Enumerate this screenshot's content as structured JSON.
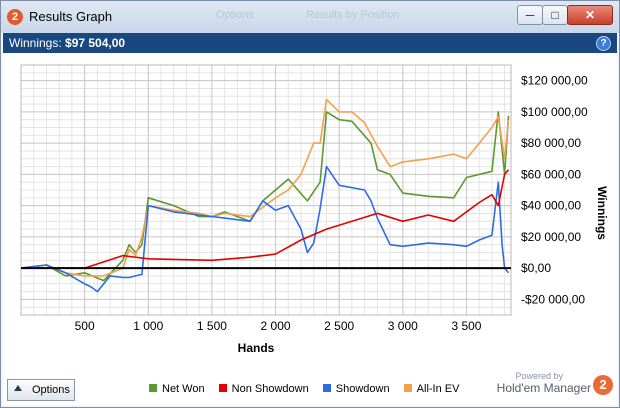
{
  "window": {
    "title": "Results Graph",
    "app_icon": "hm2-logo-icon",
    "background_tabs": [
      "Options",
      "Results by Position"
    ],
    "controls": {
      "minimize": "─",
      "maximize": "□",
      "close": "✕"
    }
  },
  "header": {
    "label": "Winnings:",
    "value": "$97 504,00",
    "help": "?"
  },
  "footer": {
    "options_label": "Options",
    "powered_by": "Powered by",
    "brand": "Hold'em Manager",
    "brand_logo_text": "2"
  },
  "colors": {
    "net_won": "#5a9a2e",
    "non_showdown": "#e30000",
    "showdown": "#2e6be6",
    "all_in_ev": "#f6a04d",
    "title_bar": "#19477f"
  },
  "chart_data": {
    "type": "line",
    "xlabel": "Hands",
    "ylabel": "Winnings",
    "xlim": [
      0,
      3850
    ],
    "ylim": [
      -30000,
      130000
    ],
    "x_ticks": [
      500,
      1000,
      1500,
      2000,
      2500,
      3000,
      3500
    ],
    "x_tick_labels": [
      "500",
      "1 000",
      "1 500",
      "2 000",
      "2 500",
      "3 000",
      "3 500"
    ],
    "y_ticks": [
      -20000,
      0,
      20000,
      40000,
      60000,
      80000,
      100000,
      120000
    ],
    "y_tick_labels": [
      "-$20 000,00",
      "$0,00",
      "$20 000,00",
      "$40 000,00",
      "$60 000,00",
      "$80 000,00",
      "$100 000,00",
      "$120 000,00"
    ],
    "grid": true,
    "legend_position": "bottom",
    "series": [
      {
        "name": "Net Won",
        "x": [
          0,
          200,
          350,
          500,
          650,
          800,
          850,
          900,
          950,
          1000,
          1200,
          1400,
          1500,
          1600,
          1800,
          1900,
          2000,
          2100,
          2250,
          2350,
          2400,
          2500,
          2600,
          2750,
          2800,
          2900,
          3000,
          3200,
          3400,
          3500,
          3700,
          3750,
          3800,
          3830
        ],
        "values": [
          0,
          2000,
          -5000,
          -3000,
          -8000,
          5000,
          15000,
          10000,
          15000,
          45000,
          40000,
          33000,
          33000,
          36000,
          30000,
          43000,
          50000,
          57000,
          43000,
          55000,
          100000,
          95000,
          94000,
          80000,
          63000,
          60000,
          48000,
          46000,
          45000,
          58000,
          62000,
          100000,
          60000,
          97500
        ]
      },
      {
        "name": "Non Showdown",
        "x": [
          0,
          500,
          800,
          1000,
          1500,
          1800,
          2000,
          2200,
          2400,
          2800,
          3000,
          3200,
          3400,
          3600,
          3700,
          3750,
          3800,
          3830
        ],
        "values": [
          0,
          0,
          8000,
          6000,
          5000,
          7000,
          9000,
          18000,
          25000,
          35000,
          30000,
          34000,
          30000,
          42000,
          47000,
          40000,
          60000,
          63000
        ]
      },
      {
        "name": "Showdown",
        "x": [
          0,
          200,
          350,
          500,
          550,
          600,
          700,
          800,
          850,
          900,
          950,
          1000,
          1200,
          1400,
          1600,
          1800,
          1900,
          2000,
          2100,
          2200,
          2250,
          2300,
          2350,
          2400,
          2500,
          2700,
          2750,
          2800,
          2900,
          3000,
          3200,
          3400,
          3500,
          3600,
          3700,
          3750,
          3780,
          3800,
          3830
        ],
        "values": [
          0,
          2000,
          -3000,
          -10000,
          -12000,
          -15000,
          -5000,
          -6000,
          -6000,
          -5000,
          -4000,
          40000,
          36000,
          34000,
          32000,
          30000,
          43000,
          37000,
          40000,
          25000,
          10000,
          16000,
          38000,
          65000,
          53000,
          50000,
          43000,
          32000,
          15000,
          14000,
          16000,
          15000,
          14000,
          18000,
          21000,
          55000,
          15000,
          0,
          -3000
        ]
      },
      {
        "name": "All-In EV",
        "x": [
          0,
          200,
          350,
          500,
          650,
          800,
          850,
          900,
          950,
          1000,
          1200,
          1400,
          1500,
          1600,
          1800,
          2000,
          2100,
          2200,
          2300,
          2350,
          2400,
          2500,
          2600,
          2700,
          2800,
          2900,
          3000,
          3200,
          3400,
          3500,
          3600,
          3700,
          3750,
          3800,
          3830
        ],
        "values": [
          0,
          2000,
          -3000,
          -5000,
          -5000,
          0,
          12000,
          8000,
          20000,
          40000,
          37000,
          35000,
          33000,
          35000,
          33000,
          45000,
          50000,
          60000,
          80000,
          80000,
          108000,
          100000,
          100000,
          93000,
          78000,
          65000,
          68000,
          70000,
          73000,
          70000,
          80000,
          90000,
          97000,
          70000,
          95000
        ]
      }
    ]
  }
}
